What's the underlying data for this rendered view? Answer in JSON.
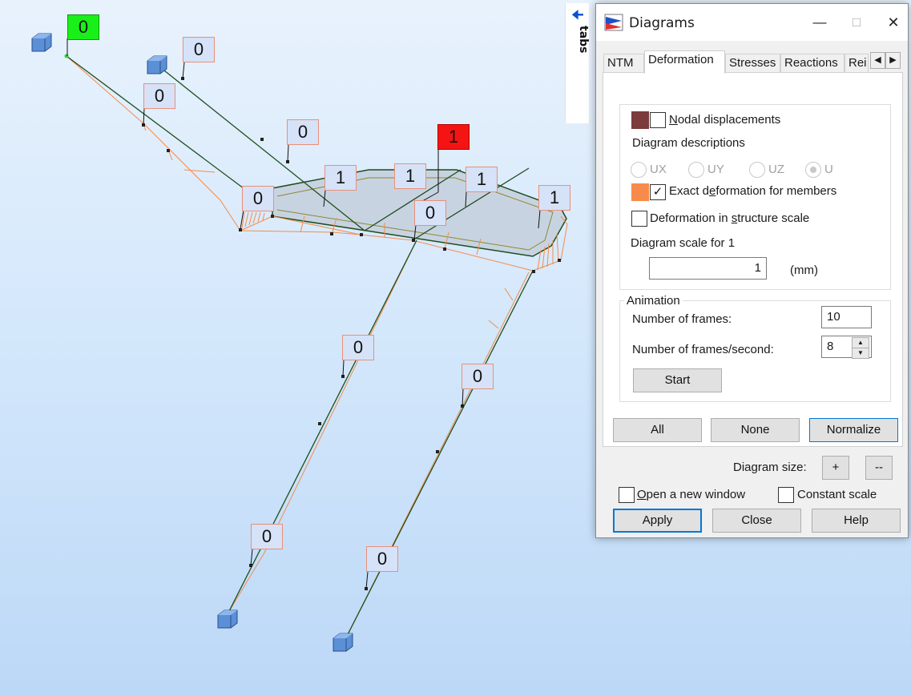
{
  "model_labels": {
    "g1": "0",
    "a1": "0",
    "b1": "0",
    "c1": "0",
    "d1": "0",
    "e1": "1",
    "r1": "1",
    "f1": "1",
    "h1": "1",
    "i1": "0",
    "j1": "1",
    "k1": "0",
    "l1": "0",
    "m1": "0",
    "n1": "0"
  },
  "tabs_strip": {
    "label": "tabs",
    "arrow_icon": "arrow-left-icon"
  },
  "dialog": {
    "title": "Diagrams",
    "tabs": [
      "NTM",
      "Deformation",
      "Stresses",
      "Reactions",
      "Rei"
    ],
    "nodal": {
      "color": "#7b3b3b",
      "label_pre": "",
      "label_ul": "N",
      "label_post": "odal displacements",
      "checked": ""
    },
    "diagram_descriptions": "Diagram descriptions",
    "radios": [
      "UX",
      "UY",
      "UZ",
      "U"
    ],
    "exact": {
      "color": "#f68b4b",
      "label_pre": "Exact d",
      "label_ul": "e",
      "label_post": "formation for members",
      "checked": "✓"
    },
    "struct_scale": {
      "label_pre": "Deformation in ",
      "label_ul": "s",
      "label_post": "tructure scale",
      "checked": ""
    },
    "scale_label": "Diagram scale for 1",
    "scale_value": "1",
    "scale_unit": "(mm)",
    "animation": {
      "title": "Animation",
      "frames_label": "Number of frames:",
      "frames_value": "10",
      "fps_label": "Number of frames/second:",
      "fps_value": "8",
      "start": "Start"
    },
    "buttons": {
      "all": "All",
      "none": "None",
      "normalize": "Normalize"
    },
    "diagram_size": "Diagram size:",
    "plus": "+",
    "minus": "--",
    "open_window": {
      "label_pre": "",
      "label_ul": "O",
      "label_post": "pen a new window",
      "checked": ""
    },
    "constant_scale": {
      "label": "Constant scale",
      "checked": ""
    },
    "footer": {
      "apply": "Apply",
      "close": "Close",
      "help": "Help"
    }
  },
  "colors": {
    "member": "#1d4d1d",
    "diagram": "#f68b4b",
    "slab_fill": "#c8d3e2",
    "support": "#5b8fd6",
    "label_border": "#e8907a",
    "accent": "#0078d7"
  }
}
